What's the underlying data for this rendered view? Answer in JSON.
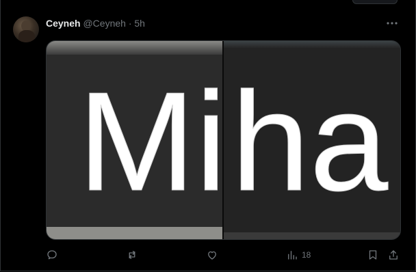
{
  "post": {
    "display_name": "Ceyneh",
    "handle": "@Ceyneh",
    "separator": "·",
    "time": "5h",
    "more_icon": "more-horizontal-icon"
  },
  "media": {
    "text_left": "Mi",
    "text_right": "ha"
  },
  "actions": {
    "reply_icon": "reply-icon",
    "repost_icon": "repost-icon",
    "like_icon": "heart-icon",
    "views_icon": "views-chart-icon",
    "views_count": "18",
    "bookmark_icon": "bookmark-icon",
    "share_icon": "share-icon"
  },
  "colors": {
    "background": "#000000",
    "border": "#2f3336",
    "text": "#e7e9ea",
    "muted": "#71767b"
  }
}
